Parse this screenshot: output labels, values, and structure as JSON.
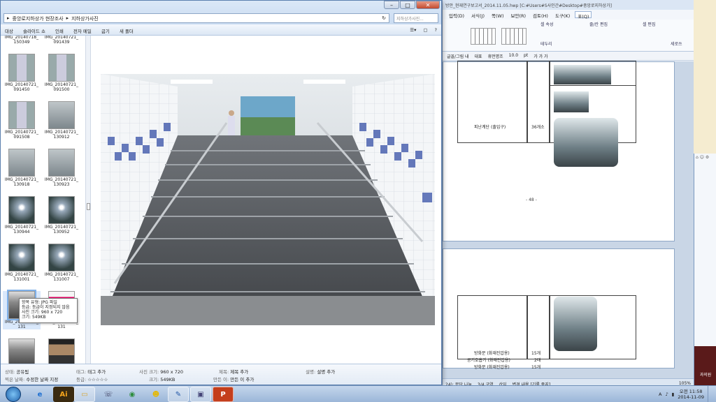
{
  "explorer": {
    "breadcrumb": [
      "중앙로지하상가 현장조사",
      "지하상가사진"
    ],
    "search_placeholder": "지하상가사진...",
    "toolbar": [
      "대상",
      "슬라이드 쇼",
      "인쇄",
      "전자 메일",
      "굽기",
      "새 폴더"
    ],
    "files": [
      {
        "name": "IMG_20140718_ 150349",
        "thumb": "door",
        "clipped": true
      },
      {
        "name": "IMG_20140721_ 091439",
        "thumb": "door",
        "clipped": true
      },
      {
        "name": "IMG_20140721_ 091450",
        "thumb": "door"
      },
      {
        "name": "IMG_20140721_ 091500",
        "thumb": "door"
      },
      {
        "name": "IMG_20140721_ 091508",
        "thumb": "door"
      },
      {
        "name": "IMG_20140721_ 130912",
        "thumb": "panel"
      },
      {
        "name": "IMG_20140721_ 130918",
        "thumb": "panel"
      },
      {
        "name": "IMG_20140721_ 130923",
        "thumb": "panel"
      },
      {
        "name": "IMG_20140721_ 130944",
        "thumb": "corr"
      },
      {
        "name": "IMG_20140721_ 130952",
        "thumb": "corr"
      },
      {
        "name": "IMG_20140721_ 131001",
        "thumb": "corr"
      },
      {
        "name": "IMG_20140721_ 131007",
        "thumb": "corr"
      },
      {
        "name": "IMG_20140721_ 131",
        "thumb": "stair",
        "selected": true
      },
      {
        "name": "IMG_20140721_ 131",
        "thumb": "pink"
      },
      {
        "name": "IMG_20140721_ 131103",
        "thumb": "stair"
      },
      {
        "name": "IMG_20140721_ 131118",
        "thumb": "people"
      }
    ],
    "tooltip": [
      "항목 유형: JPG 파일",
      "등급: 등급이 지정되지 않음",
      "사진 크기: 960 x 720",
      "크기: 549KB"
    ],
    "details": {
      "state_label": "상태:",
      "state_value": "공유됨",
      "date_label": "찍은 날짜:",
      "date_value": "수정한 날짜 지정",
      "tag_label": "태그:",
      "tag_value": "태그 추가",
      "rating_label": "등급:",
      "rating_value": "☆☆☆☆☆",
      "dim_label": "사진 크기:",
      "dim_value": "960 x 720",
      "size_label": "크기:",
      "size_value": "549KB",
      "title_label": "제목:",
      "title_value": "제목 추가",
      "author_label": "만든 이:",
      "author_value": "만든 이 추가",
      "desc_label": "설명:",
      "desc_value": "설명 추가"
    }
  },
  "hwp": {
    "title": "방안_현재연구보고서_2014.11.05.hwp [C:#Users#S사인간#Desktop#중앙로지하상가]",
    "menu": [
      "입력(D)",
      "서식(J)",
      "쪽(W)",
      "보안(R)",
      "검토(H)",
      "도구(K)",
      "표(Q)"
    ],
    "ribbon_groups": [
      "셀 속성",
      "줄/칸 편집",
      "셀 편집"
    ],
    "ribbon_buttons": [
      "테두리",
      "세로쓰"
    ],
    "fmt": [
      "글꼴/그림 내",
      "대표",
      "휴먼명조",
      "10.0",
      "pt",
      "가 가 가"
    ],
    "page1": {
      "row_label": "피난계단 (출입구)",
      "row_count": "36개소",
      "page_no": "- 48 -"
    },
    "page2": {
      "rows": [
        {
          "label": "방화문 (화재진압용)",
          "count": "15개"
        },
        {
          "label": "공기호흡기 (화재진압용)",
          "count": "2대"
        },
        {
          "label": "방화문 (화재진압용)",
          "count": "15개"
        }
      ]
    },
    "status": [
      "24): 문단 나눔",
      "3/4 구역",
      "삽입",
      "변경 내용 [기록 중지]",
      "105%"
    ]
  },
  "side": {
    "brand": "과의원",
    "label": "정보"
  },
  "taskbar": {
    "apps": [
      "ie",
      "ai",
      "explorer",
      "network",
      "chrome",
      "messenger",
      "hwp",
      "viewer",
      "ppt"
    ],
    "tray_lang": "A",
    "time": "오전 11:58",
    "date": "2014-11-09"
  }
}
